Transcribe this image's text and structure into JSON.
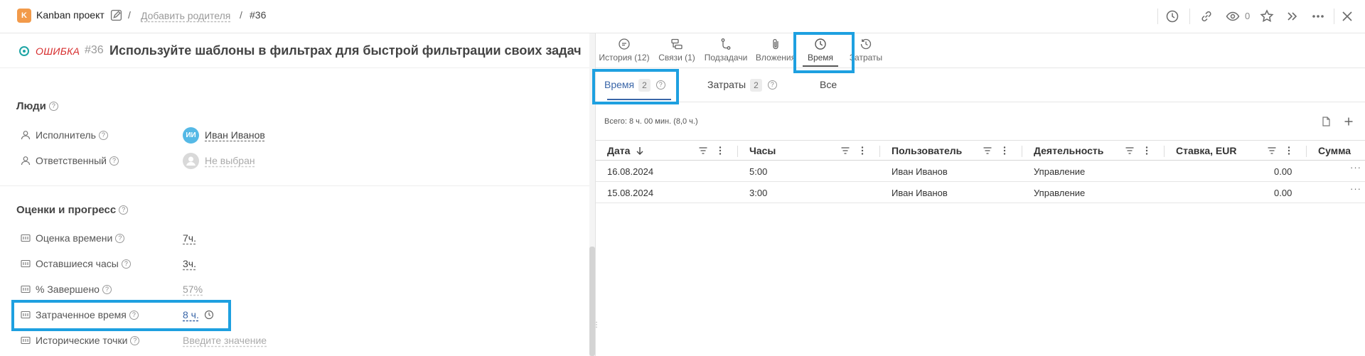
{
  "topbar": {
    "project_badge": "K",
    "project_name": "Kanban проект",
    "separator": "/",
    "add_parent": "Добавить родителя",
    "task_ref": "#36",
    "watch_count": "0"
  },
  "task": {
    "status": "ОШИБКА",
    "id": "#36",
    "title": "Используйте шаблоны в фильтрах для быстрой фильтрации своих задач"
  },
  "people": {
    "heading": "Люди",
    "assignee_label": "Исполнитель",
    "assignee_initials": "ИИ",
    "assignee_value": "Иван Иванов",
    "responsible_label": "Ответственный",
    "responsible_value": "Не выбран"
  },
  "progress": {
    "heading": "Оценки и прогресс",
    "estimate_label": "Оценка времени",
    "estimate_value": "7ч.",
    "remaining_label": "Оставшиеся часы",
    "remaining_value": "3ч.",
    "percent_label": "% Завершено",
    "percent_value": "57%",
    "spent_label": "Затраченное время",
    "spent_value": "8 ч.",
    "story_label": "Исторические точки",
    "story_placeholder": "Введите значение"
  },
  "right_tabs": [
    {
      "label": "История (12)",
      "icon": "comment-icon"
    },
    {
      "label": "Связи (1)",
      "icon": "relations-icon"
    },
    {
      "label": "Подзадачи",
      "icon": "subtasks-icon"
    },
    {
      "label": "Вложения",
      "icon": "paperclip-icon"
    },
    {
      "label": "Время",
      "icon": "clock-icon"
    },
    {
      "label": "Затраты",
      "icon": "history-clock-icon"
    }
  ],
  "sub_tabs": {
    "time_label": "Время",
    "time_count": "2",
    "costs_label": "Затраты",
    "costs_count": "2",
    "all_label": "Все"
  },
  "summary": "Всего: 8 ч. 00 мин. (8,0 ч.)",
  "grid": {
    "columns": [
      "Дата",
      "Часы",
      "Пользователь",
      "Деятельность",
      "Ставка, EUR",
      "Сумма"
    ],
    "rows": [
      {
        "date": "16.08.2024",
        "hours": "5:00",
        "user": "Иван Иванов",
        "activity": "Управление",
        "rate": "0.00"
      },
      {
        "date": "15.08.2024",
        "hours": "3:00",
        "user": "Иван Иванов",
        "activity": "Управление",
        "rate": "0.00"
      }
    ],
    "row_more": "···"
  },
  "colors": {
    "accent": "#3a66a8",
    "highlight": "#1ea0e0",
    "bug": "#d62b2b",
    "status": "#1ea5a5",
    "project_badge": "#f29a4a"
  }
}
